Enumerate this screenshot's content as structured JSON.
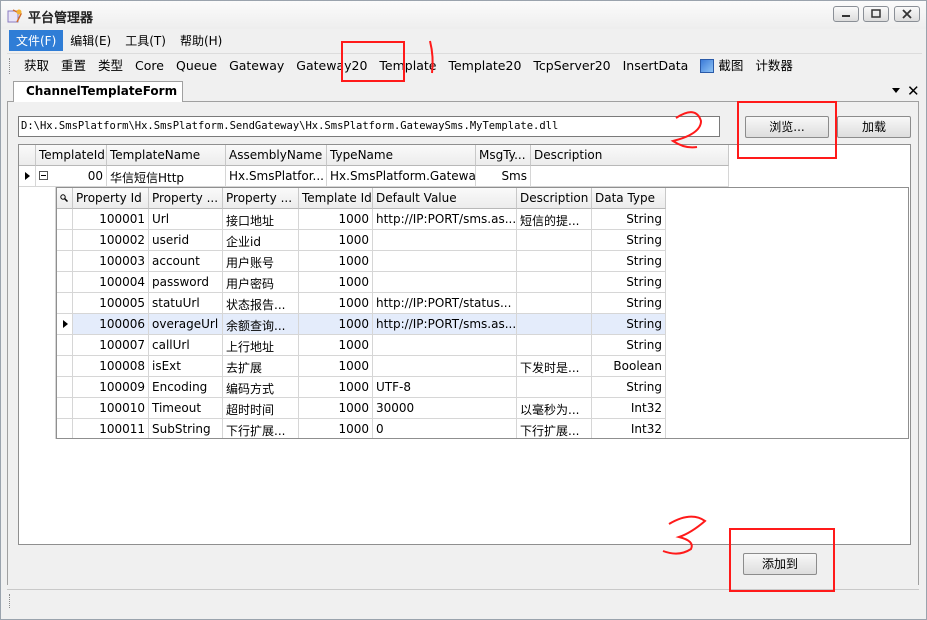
{
  "window": {
    "title": "平台管理器"
  },
  "menu": [
    {
      "label": "文件(F)",
      "active": true
    },
    {
      "label": "编辑(E)",
      "active": false
    },
    {
      "label": "工具(T)",
      "active": false
    },
    {
      "label": "帮助(H)",
      "active": false
    }
  ],
  "toolbar": [
    "获取",
    "重置",
    "类型",
    "Core",
    "Queue",
    "Gateway",
    "Gateway20",
    "Template",
    "Template20",
    "TcpServer20",
    "InsertData",
    "截图",
    "计数器"
  ],
  "tab": {
    "label": "ChannelTemplateForm"
  },
  "path": {
    "value": "D:\\Hx.SmsPlatform\\Hx.SmsPlatform.SendGateway\\Hx.SmsPlatform.GatewaySms.MyTemplate.dll"
  },
  "buttons": {
    "browse": "浏览...",
    "load": "加载",
    "add": "添加到"
  },
  "master_grid": {
    "columns": [
      "TemplateId",
      "TemplateName",
      "AssemblyName",
      "TypeName",
      "MsgTy...",
      "Description"
    ],
    "row": {
      "id": "00",
      "name": "华信短信Http",
      "assembly": "Hx.SmsPlatfor...",
      "type": "Hx.SmsPlatform.Gatewa...",
      "msgtype": "Sms",
      "description": ""
    }
  },
  "detail_grid": {
    "columns": [
      "Property Id",
      "Property ...",
      "Property ...",
      "Template Id",
      "Default Value",
      "Description",
      "Data Type"
    ],
    "rows": [
      {
        "id": "100001",
        "name": "Url",
        "label": "接口地址",
        "tid": "1000",
        "default": "http://IP:PORT/sms.as...",
        "desc": "短信的提...",
        "type": "String"
      },
      {
        "id": "100002",
        "name": "userid",
        "label": "企业id",
        "tid": "1000",
        "default": "",
        "desc": "",
        "type": "String"
      },
      {
        "id": "100003",
        "name": "account",
        "label": "用户账号",
        "tid": "1000",
        "default": "",
        "desc": "",
        "type": "String"
      },
      {
        "id": "100004",
        "name": "password",
        "label": "用户密码",
        "tid": "1000",
        "default": "",
        "desc": "",
        "type": "String"
      },
      {
        "id": "100005",
        "name": "statuUrl",
        "label": "状态报告...",
        "tid": "1000",
        "default": "http://IP:PORT/status...",
        "desc": "",
        "type": "String"
      },
      {
        "id": "100006",
        "name": "overageUrl",
        "label": "余额查询...",
        "tid": "1000",
        "default": "http://IP:PORT/sms.as...",
        "desc": "",
        "type": "String"
      },
      {
        "id": "100007",
        "name": "callUrl",
        "label": "上行地址",
        "tid": "1000",
        "default": "",
        "desc": "",
        "type": "String"
      },
      {
        "id": "100008",
        "name": "isExt",
        "label": "去扩展",
        "tid": "1000",
        "default": "",
        "desc": "下发时是...",
        "type": "Boolean"
      },
      {
        "id": "100009",
        "name": "Encoding",
        "label": "编码方式",
        "tid": "1000",
        "default": "UTF-8",
        "desc": "",
        "type": "String"
      },
      {
        "id": "100010",
        "name": "Timeout",
        "label": "超时时间",
        "tid": "1000",
        "default": "30000",
        "desc": "以毫秒为...",
        "type": "Int32"
      },
      {
        "id": "100011",
        "name": "SubString",
        "label": "下行扩展...",
        "tid": "1000",
        "default": "0",
        "desc": "下行扩展...",
        "type": "Int32"
      }
    ],
    "selected_index": 5
  },
  "colors": {
    "menu_active": "#2f7dd6",
    "selection": "#e4ecfb",
    "annotation": "#ff1a1a"
  }
}
